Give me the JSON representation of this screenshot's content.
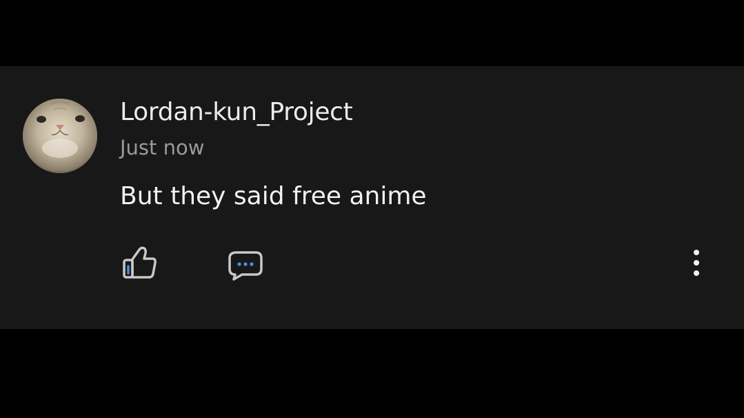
{
  "comment": {
    "username": "Lordan-kun_Project",
    "timestamp": "Just now",
    "text": "But they said free anime"
  },
  "avatar": {
    "image": "cat-face-photo"
  },
  "actions": {
    "like_icon": "thumbs-up-icon",
    "reply_icon": "chat-bubble-icon",
    "more_icon": "vertical-ellipsis-icon"
  },
  "colors": {
    "card_background": "#181818",
    "letterbox": "#000000",
    "accent": "#4a8fe0",
    "icon": "#c8c8c8"
  }
}
